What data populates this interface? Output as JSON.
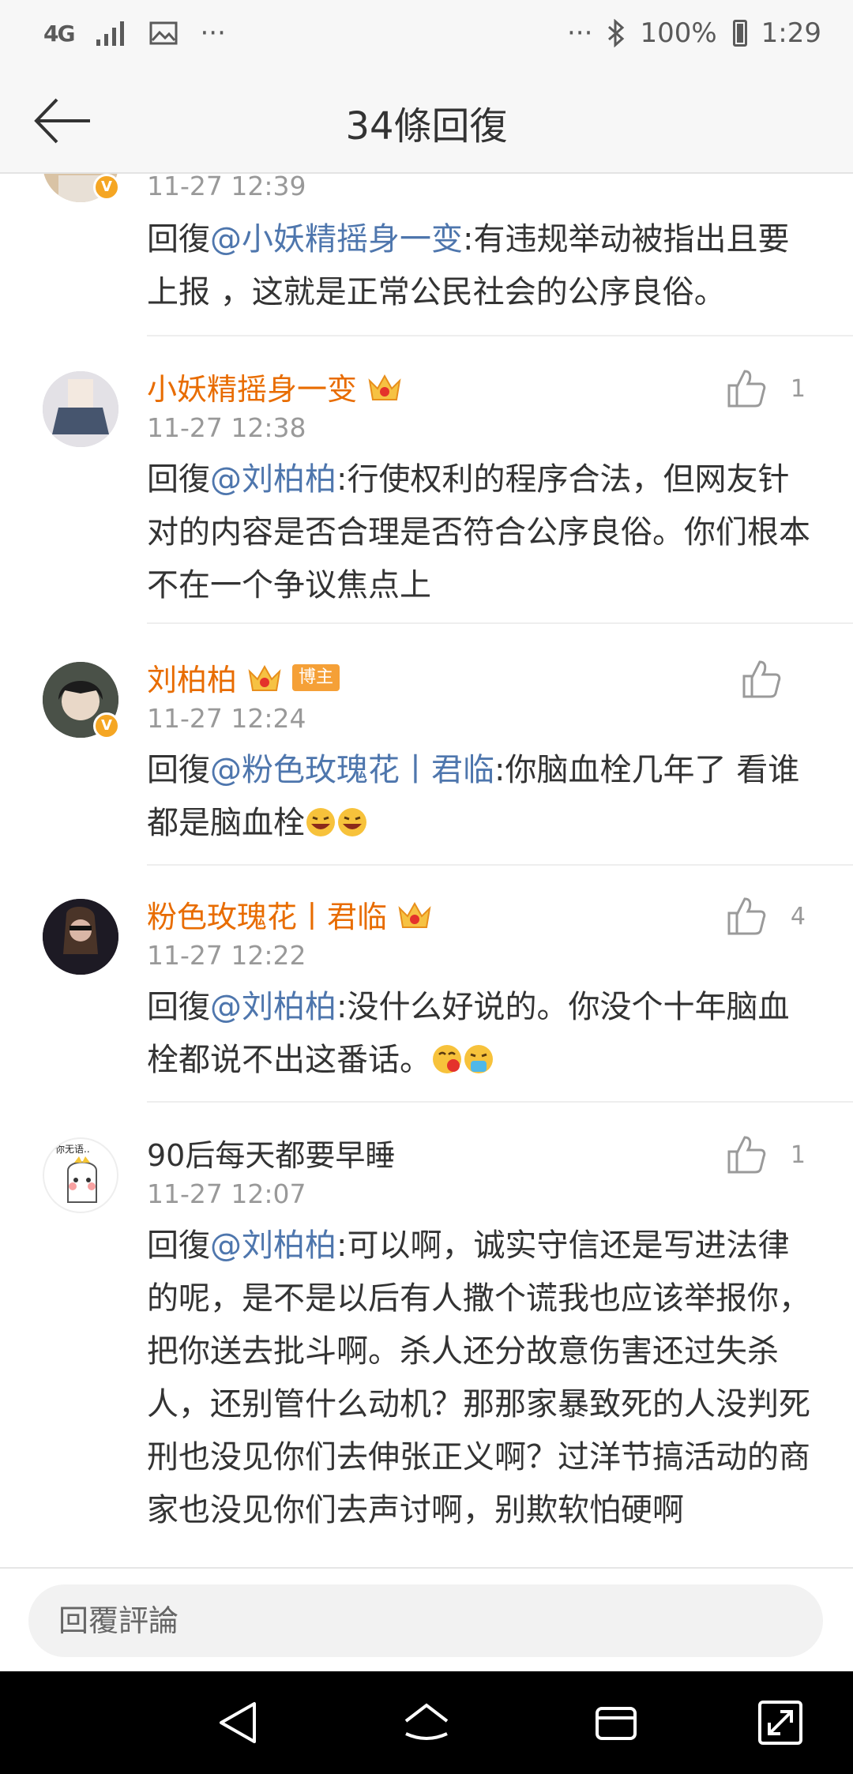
{
  "status_bar": {
    "network": "4G",
    "dots_left": "···",
    "dots_right": "···",
    "battery": "100%",
    "time": "1:29"
  },
  "header": {
    "title": "34條回復"
  },
  "comments": [
    {
      "time": "11-27 12:39",
      "prefix": "回復",
      "mention": "@小妖精摇身一变",
      "text": ":有违规举动被指出且要上报 ，这就是正常公民社会的公序良俗。"
    },
    {
      "name": "小妖精摇身一变",
      "time": "11-27 12:38",
      "likes": "1",
      "prefix": "回復",
      "mention": "@刘柏柏",
      "text": ":行使权利的程序合法，但网友针对的内容是否合理是否符合公序良俗。你们根本不在一个争议焦点上"
    },
    {
      "name": "刘柏柏",
      "badge": "博主",
      "time": "11-27 12:24",
      "likes": "",
      "prefix": "回復",
      "mention": "@粉色玫瑰花丨君临",
      "text": ":你脑血栓几年了 看谁都是脑血栓"
    },
    {
      "name": "粉色玫瑰花丨君临",
      "time": "11-27 12:22",
      "likes": "4",
      "prefix": "回復",
      "mention": "@刘柏柏",
      "text": ":没什么好说的。你没个十年脑血栓都说不出这番话。"
    },
    {
      "name": "90后每天都要早睡",
      "avatar_caption": "你无语..",
      "time": "11-27 12:07",
      "likes": "1",
      "prefix": "回復",
      "mention": "@刘柏柏",
      "text": ":可以啊，诚实守信还是写进法律的呢，是不是以后有人撒个谎我也应该举报你，把你送去批斗啊。杀人还分故意伤害还过失杀人，还别管什么动机？那那家暴致死的人没判死刑也没见你们去伸张正义啊？过洋节搞活动的商家也没见你们去声讨啊，别欺软怕硬啊"
    }
  ],
  "reply_bar": {
    "placeholder": "回覆評論"
  },
  "colors": {
    "username": "#e86c00",
    "mention": "#4e76ad",
    "timestamp": "#999999",
    "badge": "#f5a037"
  },
  "icons": [
    "back-arrow-icon",
    "thumbs-up-icon",
    "crown-icon",
    "verified-icon",
    "nav-back-icon",
    "nav-home-icon",
    "nav-recents-icon",
    "nav-expand-icon"
  ]
}
